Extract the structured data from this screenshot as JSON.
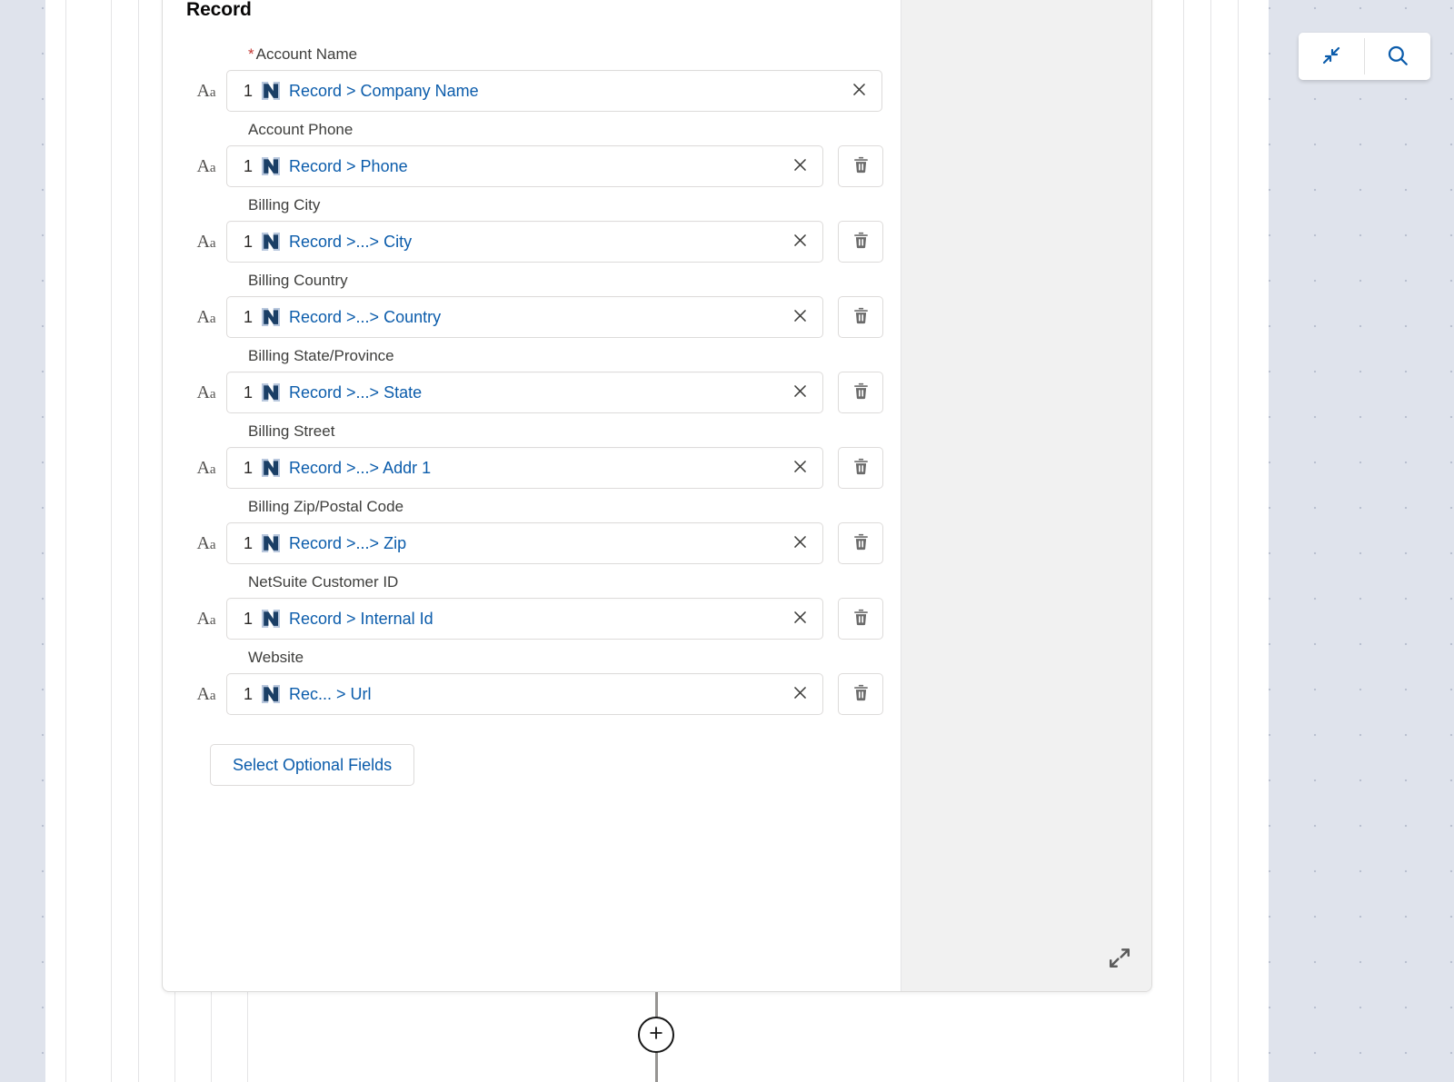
{
  "canvas": {
    "background_color": "#dfe3ec",
    "dot_color": "#b9c0d0",
    "lane_color": "#ffffff"
  },
  "toolbar": {
    "collapse_icon": "collapse-arrows-icon",
    "search_icon": "search-icon",
    "accent_color": "#0b5cab"
  },
  "card": {
    "title": "Record",
    "expand_handle_icon": "expand-diagonal-icon",
    "optional_fields_label": "Select Optional Fields",
    "panel_color": "#f1f1f1"
  },
  "field_icons": {
    "type_text": "Aa",
    "source_icon": "netsuite-logo-icon",
    "clear_icon": "close-x-icon",
    "delete_icon": "trash-icon"
  },
  "fields": [
    {
      "label": "Account Name",
      "required": true,
      "index": "1",
      "value": "Record > Company Name",
      "deletable": false
    },
    {
      "label": "Account Phone",
      "required": false,
      "index": "1",
      "value": "Record > Phone",
      "deletable": true
    },
    {
      "label": "Billing City",
      "required": false,
      "index": "1",
      "value": "Record >...> City",
      "deletable": true
    },
    {
      "label": "Billing Country",
      "required": false,
      "index": "1",
      "value": "Record >...> Country",
      "deletable": true
    },
    {
      "label": "Billing State/Province",
      "required": false,
      "index": "1",
      "value": "Record >...> State",
      "deletable": true
    },
    {
      "label": "Billing Street",
      "required": false,
      "index": "1",
      "value": "Record >...> Addr 1",
      "deletable": true
    },
    {
      "label": "Billing Zip/Postal Code",
      "required": false,
      "index": "1",
      "value": "Record >...> Zip",
      "deletable": true
    },
    {
      "label": "NetSuite Customer ID",
      "required": false,
      "index": "1",
      "value": "Record > Internal Id",
      "deletable": true
    },
    {
      "label": "Website",
      "required": false,
      "index": "1",
      "value": "Rec...  > Url",
      "deletable": true
    }
  ],
  "connector": {
    "add_node_icon": "plus-icon",
    "line_color": "#969492"
  }
}
